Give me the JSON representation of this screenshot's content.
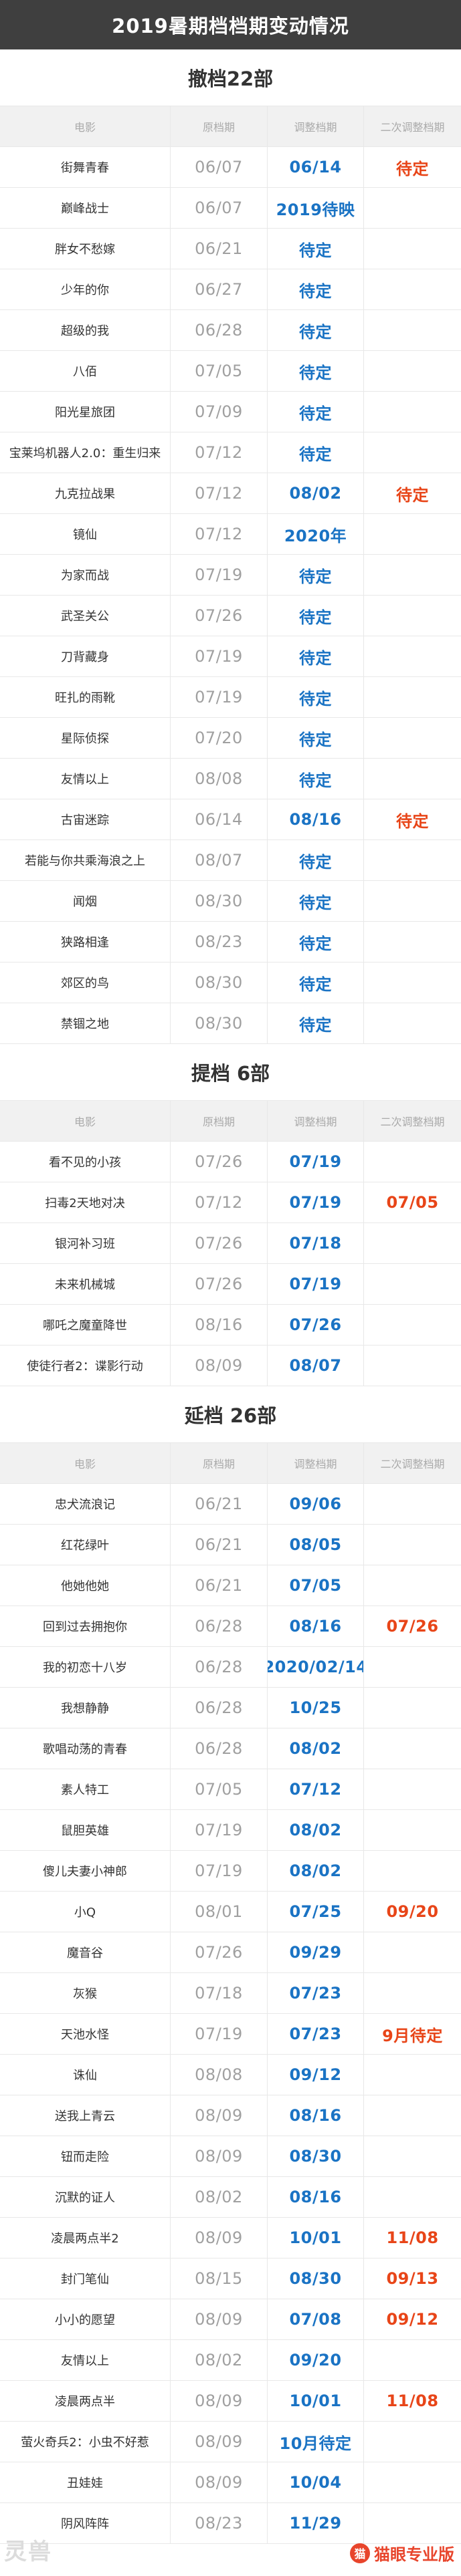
{
  "title": "2019暑期档档期变动情况",
  "headers": {
    "film": "电影",
    "orig": "原档期",
    "adj": "调整档期",
    "adj2": "二次调整档期"
  },
  "sections": [
    {
      "title": "撤档22部",
      "rows": [
        {
          "film": "街舞青春",
          "orig": "06/07",
          "adj": "06/14",
          "adj2": "待定"
        },
        {
          "film": "巅峰战士",
          "orig": "06/07",
          "adj": "2019待映",
          "adj2": ""
        },
        {
          "film": "胖女不愁嫁",
          "orig": "06/21",
          "adj": "待定",
          "adj2": ""
        },
        {
          "film": "少年的你",
          "orig": "06/27",
          "adj": "待定",
          "adj2": ""
        },
        {
          "film": "超级的我",
          "orig": "06/28",
          "adj": "待定",
          "adj2": ""
        },
        {
          "film": "八佰",
          "orig": "07/05",
          "adj": "待定",
          "adj2": ""
        },
        {
          "film": "阳光星旅团",
          "orig": "07/09",
          "adj": "待定",
          "adj2": ""
        },
        {
          "film": "宝莱坞机器人2.0：重生归来",
          "orig": "07/12",
          "adj": "待定",
          "adj2": ""
        },
        {
          "film": "九克拉战果",
          "orig": "07/12",
          "adj": "08/02",
          "adj2": "待定"
        },
        {
          "film": "镜仙",
          "orig": "07/12",
          "adj": "2020年",
          "adj2": ""
        },
        {
          "film": "为家而战",
          "orig": "07/19",
          "adj": "待定",
          "adj2": ""
        },
        {
          "film": "武圣关公",
          "orig": "07/26",
          "adj": "待定",
          "adj2": ""
        },
        {
          "film": "刀背藏身",
          "orig": "07/19",
          "adj": "待定",
          "adj2": ""
        },
        {
          "film": "旺扎的雨靴",
          "orig": "07/19",
          "adj": "待定",
          "adj2": ""
        },
        {
          "film": "星际侦探",
          "orig": "07/20",
          "adj": "待定",
          "adj2": ""
        },
        {
          "film": "友情以上",
          "orig": "08/08",
          "adj": "待定",
          "adj2": ""
        },
        {
          "film": "古宙迷踪",
          "orig": "06/14",
          "adj": "08/16",
          "adj2": "待定"
        },
        {
          "film": "若能与你共乘海浪之上",
          "orig": "08/07",
          "adj": "待定",
          "adj2": ""
        },
        {
          "film": "闻烟",
          "orig": "08/30",
          "adj": "待定",
          "adj2": ""
        },
        {
          "film": "狭路相逢",
          "orig": "08/23",
          "adj": "待定",
          "adj2": ""
        },
        {
          "film": "郊区的鸟",
          "orig": "08/30",
          "adj": "待定",
          "adj2": ""
        },
        {
          "film": "禁锢之地",
          "orig": "08/30",
          "adj": "待定",
          "adj2": ""
        }
      ]
    },
    {
      "title": "提档 6部",
      "rows": [
        {
          "film": "看不见的小孩",
          "orig": "07/26",
          "adj": "07/19",
          "adj2": ""
        },
        {
          "film": "扫毒2天地对决",
          "orig": "07/12",
          "adj": "07/19",
          "adj2": "07/05"
        },
        {
          "film": "银河补习班",
          "orig": "07/26",
          "adj": "07/18",
          "adj2": ""
        },
        {
          "film": "未来机械城",
          "orig": "07/26",
          "adj": "07/19",
          "adj2": ""
        },
        {
          "film": "哪吒之魔童降世",
          "orig": "08/16",
          "adj": "07/26",
          "adj2": ""
        },
        {
          "film": "使徒行者2：谍影行动",
          "orig": "08/09",
          "adj": "08/07",
          "adj2": ""
        }
      ]
    },
    {
      "title": "延档 26部",
      "rows": [
        {
          "film": "忠犬流浪记",
          "orig": "06/21",
          "adj": "09/06",
          "adj2": ""
        },
        {
          "film": "红花绿叶",
          "orig": "06/21",
          "adj": "08/05",
          "adj2": ""
        },
        {
          "film": "他她他她",
          "orig": "06/21",
          "adj": "07/05",
          "adj2": ""
        },
        {
          "film": "回到过去拥抱你",
          "orig": "06/28",
          "adj": "08/16",
          "adj2": "07/26"
        },
        {
          "film": "我的初恋十八岁",
          "orig": "06/28",
          "adj": "2020/02/14",
          "adj2": ""
        },
        {
          "film": "我想静静",
          "orig": "06/28",
          "adj": "10/25",
          "adj2": ""
        },
        {
          "film": "歌唱动荡的青春",
          "orig": "06/28",
          "adj": "08/02",
          "adj2": ""
        },
        {
          "film": "素人特工",
          "orig": "07/05",
          "adj": "07/12",
          "adj2": ""
        },
        {
          "film": "鼠胆英雄",
          "orig": "07/19",
          "adj": "08/02",
          "adj2": ""
        },
        {
          "film": "傻儿夫妻小神郎",
          "orig": "07/19",
          "adj": "08/02",
          "adj2": ""
        },
        {
          "film": "小Q",
          "orig": "08/01",
          "adj": "07/25",
          "adj2": "09/20"
        },
        {
          "film": "魔音谷",
          "orig": "07/26",
          "adj": "09/29",
          "adj2": ""
        },
        {
          "film": "灰猴",
          "orig": "07/18",
          "adj": "07/23",
          "adj2": ""
        },
        {
          "film": "天池水怪",
          "orig": "07/19",
          "adj": "07/23",
          "adj2": "9月待定"
        },
        {
          "film": "诛仙",
          "orig": "08/08",
          "adj": "09/12",
          "adj2": ""
        },
        {
          "film": "送我上青云",
          "orig": "08/09",
          "adj": "08/16",
          "adj2": ""
        },
        {
          "film": "钮而走险",
          "orig": "08/09",
          "adj": "08/30",
          "adj2": ""
        },
        {
          "film": "沉默的证人",
          "orig": "08/02",
          "adj": "08/16",
          "adj2": ""
        },
        {
          "film": "凌晨两点半2",
          "orig": "08/09",
          "adj": "10/01",
          "adj2": "11/08"
        },
        {
          "film": "封门笔仙",
          "orig": "08/15",
          "adj": "08/30",
          "adj2": "09/13"
        },
        {
          "film": "小小的愿望",
          "orig": "08/09",
          "adj": "07/08",
          "adj2": "09/12"
        },
        {
          "film": "友情以上",
          "orig": "08/02",
          "adj": "09/20",
          "adj2": ""
        },
        {
          "film": "凌晨两点半",
          "orig": "08/09",
          "adj": "10/01",
          "adj2": "11/08"
        },
        {
          "film": "萤火奇兵2：小虫不好惹",
          "orig": "08/09",
          "adj": "10月待定",
          "adj2": ""
        },
        {
          "film": "丑娃娃",
          "orig": "08/09",
          "adj": "10/04",
          "adj2": ""
        },
        {
          "film": "阴风阵阵",
          "orig": "08/23",
          "adj": "11/29",
          "adj2": ""
        }
      ]
    }
  ],
  "watermark": {
    "left": "灵兽",
    "icon": "猫",
    "right": "猫眼专业版"
  },
  "colors": {
    "adjusted": "#1a73c4",
    "second": "#e84518",
    "banner": "#3f3f3f"
  }
}
